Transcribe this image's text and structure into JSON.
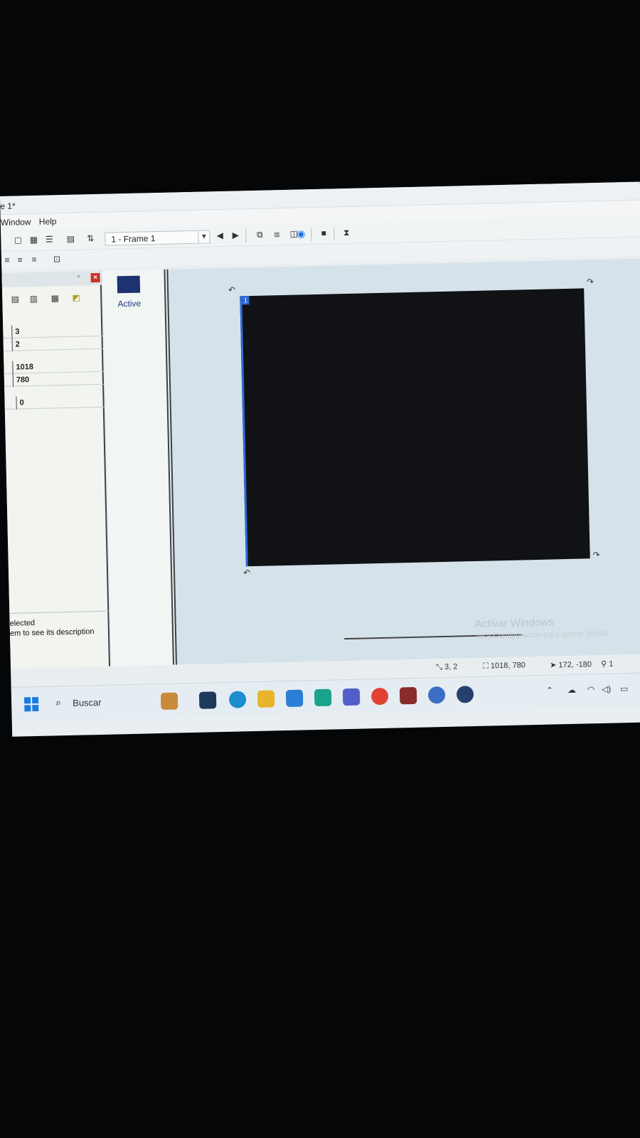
{
  "window": {
    "title": "e 1*"
  },
  "menu": {
    "items": [
      "Window",
      "Help"
    ]
  },
  "toolbar": {
    "frame_select_value": "1 - Frame 1"
  },
  "properties": {
    "rows": [
      "3",
      "2",
      "1018",
      "780",
      "0"
    ],
    "description_line1": "elected",
    "description_line2": "em to see its description"
  },
  "layers": {
    "active_label": "Active",
    "swatch_color": "#1e3270"
  },
  "canvas": {
    "frame_tag": "1",
    "background": "#101216"
  },
  "watermark": {
    "line1": "Activar Windows",
    "line2": "Ve a Configuración para activar Windo"
  },
  "status": {
    "position": "3, 2",
    "size": "1018, 780",
    "cursor": "172, -180",
    "zoom": "1"
  },
  "taskbar": {
    "search_placeholder": "Buscar"
  }
}
